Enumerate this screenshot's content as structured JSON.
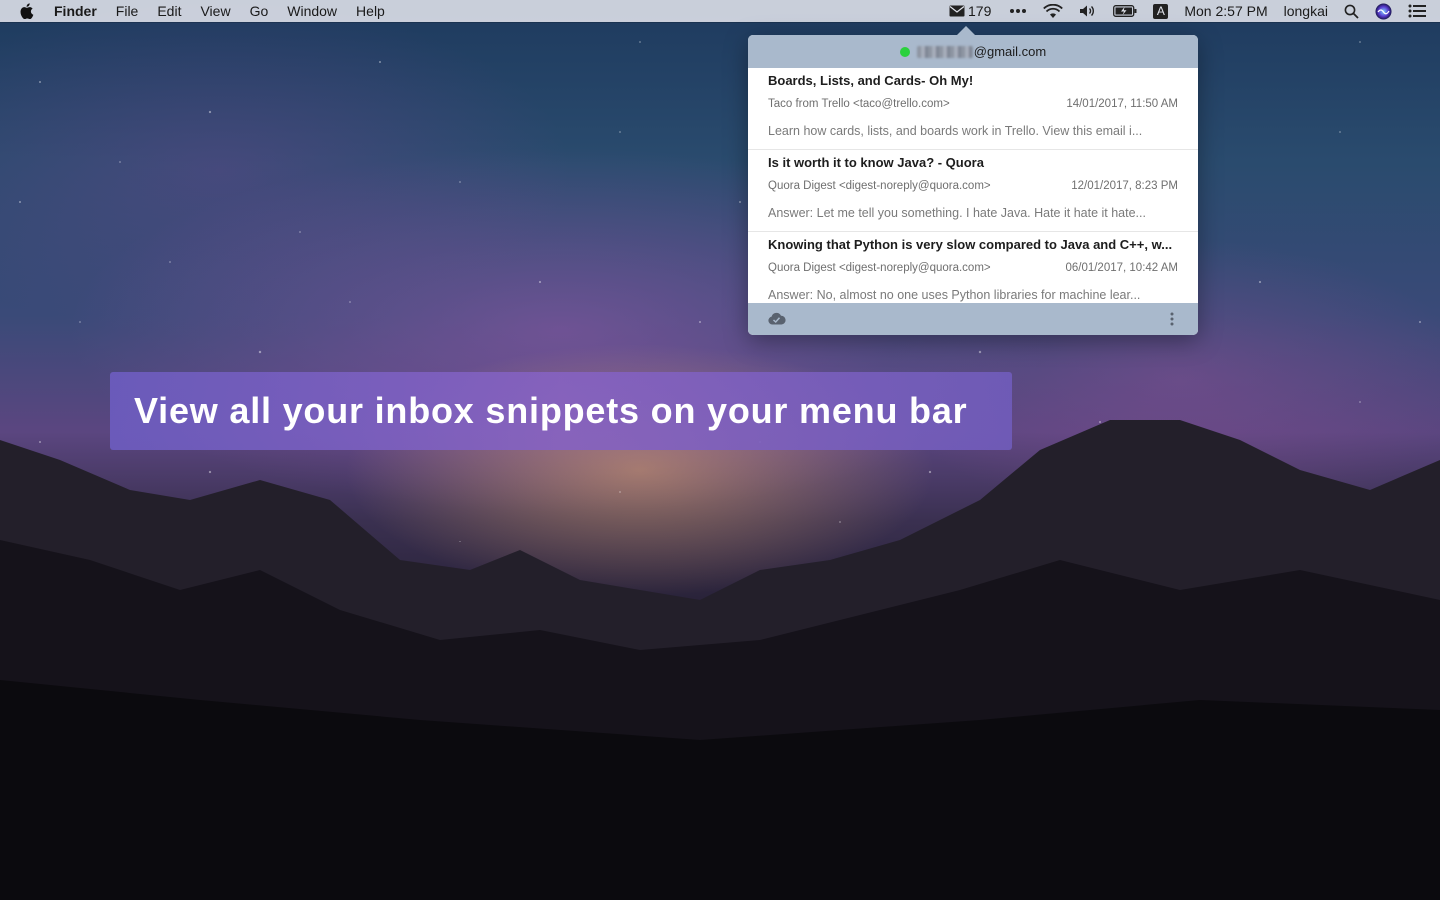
{
  "menubar": {
    "app_name": "Finder",
    "menus": [
      "File",
      "Edit",
      "View",
      "Go",
      "Window",
      "Help"
    ],
    "mail_count": "179",
    "input_source": "A",
    "clock": "Mon 2:57 PM",
    "user": "longkai",
    "icons": [
      "apple-icon",
      "mail-icon",
      "more-dots-icon",
      "wifi-icon",
      "volume-icon",
      "battery-icon",
      "input-source-icon",
      "spotlight-search-icon",
      "siri-icon",
      "notification-center-icon"
    ]
  },
  "popover": {
    "account_suffix": "@gmail.com",
    "status_color": "#2bd13d",
    "emails": [
      {
        "subject": "Boards, Lists, and Cards- Oh My!",
        "sender": "Taco from Trello <taco@trello.com>",
        "date": "14/01/2017, 11:50 AM",
        "snippet": "Learn how cards, lists, and boards work in Trello. View this email i..."
      },
      {
        "subject": "Is it worth it to know Java? - Quora",
        "sender": "Quora Digest <digest-noreply@quora.com>",
        "date": "12/01/2017, 8:23 PM",
        "snippet": "Answer: Let me tell you something. I hate Java. Hate it hate it hate..."
      },
      {
        "subject": "Knowing that Python is very slow compared to Java and C++, w...",
        "sender": "Quora Digest <digest-noreply@quora.com>",
        "date": "06/01/2017, 10:42 AM",
        "snippet": "Answer: No, almost no one uses Python libraries for machine lear..."
      }
    ],
    "footer_icons": [
      "cloud-check-icon",
      "more-vertical-icon"
    ]
  },
  "banner": {
    "text": "View all your inbox snippets on your menu bar"
  },
  "colors": {
    "menubar_bg": "#e1e4ec",
    "popover_chrome": "#a9b9cc",
    "banner_purple": "#7a60c0"
  }
}
